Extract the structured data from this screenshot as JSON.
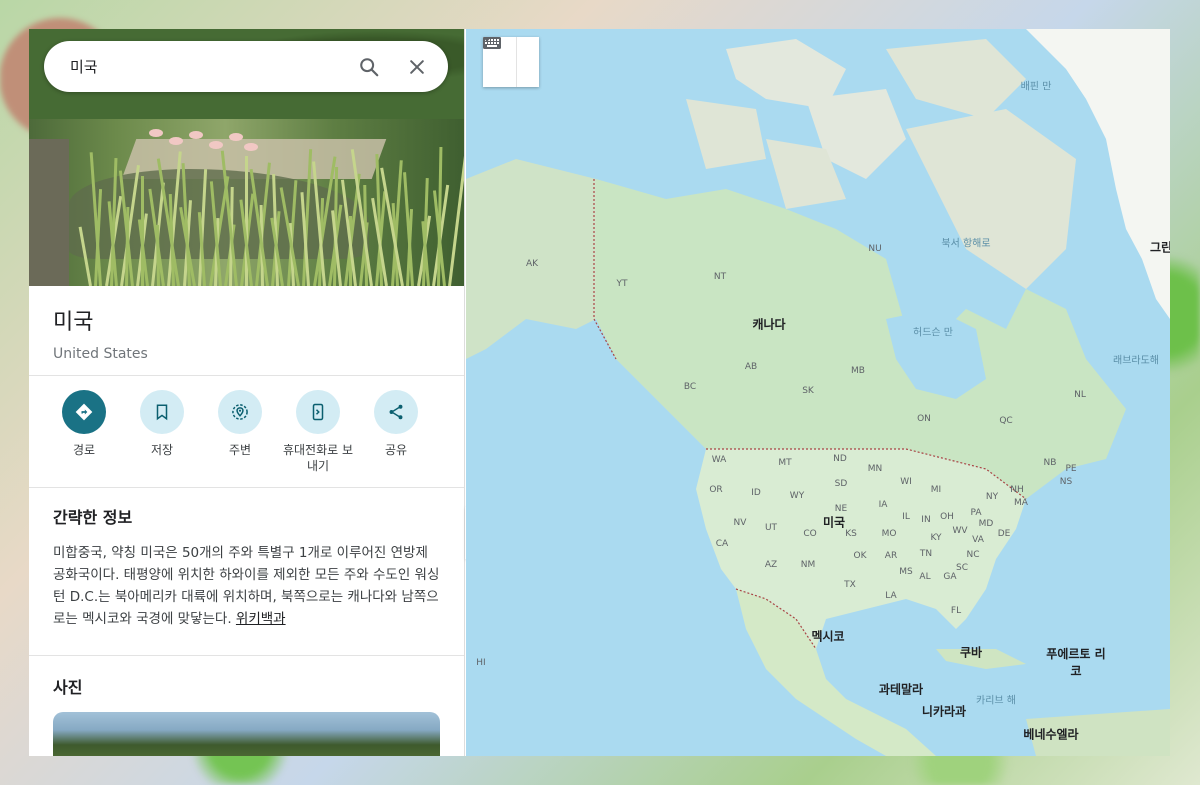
{
  "search": {
    "query": "미국"
  },
  "place": {
    "title": "미국",
    "subtitle": "United States"
  },
  "actions": [
    {
      "id": "directions",
      "label": "경로",
      "icon": "directions-icon"
    },
    {
      "id": "save",
      "label": "저장",
      "icon": "bookmark-icon"
    },
    {
      "id": "nearby",
      "label": "주변",
      "icon": "nearby-icon"
    },
    {
      "id": "send-to-phone",
      "label": "휴대전화로 보내기",
      "icon": "send-to-phone-icon"
    },
    {
      "id": "share",
      "label": "공유",
      "icon": "share-icon"
    }
  ],
  "info": {
    "title": "간략한 정보",
    "body": "미합중국, 약칭 미국은 50개의 주와 특별구 1개로 이루어진 연방제 공화국이다. 태평양에 위치한 하와이를 제외한 모든 주와 수도인 워싱턴 D.C.는 북아메리카 대륙에 위치하며, 북쪽으로는 캐나다와 남쪽으로는 멕시코와 국경에 맞닿는다.",
    "link": "위키백과"
  },
  "photos": {
    "title": "사진"
  },
  "map": {
    "countries": [
      {
        "name": "canada",
        "text": "캐나다"
      },
      {
        "name": "usa",
        "text": "미국"
      },
      {
        "name": "mexico",
        "text": "멕시코"
      },
      {
        "name": "cuba",
        "text": "쿠바"
      },
      {
        "name": "puerto-rico",
        "text": "푸에르토 리코"
      },
      {
        "name": "guatemala",
        "text": "과테말라"
      },
      {
        "name": "nicaragua",
        "text": "니카라과"
      },
      {
        "name": "venezuela",
        "text": "베네수엘라"
      },
      {
        "name": "greenland",
        "text": "그린"
      }
    ],
    "waters": [
      {
        "name": "baffin-bay",
        "text": "배핀 만"
      },
      {
        "name": "northwest-passage",
        "text": "북서 항해로"
      },
      {
        "name": "hudson-bay",
        "text": "허드슨 만"
      },
      {
        "name": "labrador-sea",
        "text": "래브라도해"
      },
      {
        "name": "caribbean-sea",
        "text": "카리브 해"
      }
    ],
    "regions": [
      "AK",
      "YT",
      "NT",
      "NU",
      "BC",
      "AB",
      "SK",
      "MB",
      "ON",
      "QC",
      "NL",
      "NB",
      "PE",
      "NS",
      "WA",
      "MT",
      "ND",
      "MN",
      "OR",
      "ID",
      "WY",
      "SD",
      "WI",
      "MI",
      "NY",
      "NH",
      "MA",
      "NE",
      "IA",
      "IL",
      "IN",
      "OH",
      "PA",
      "NV",
      "UT",
      "CO",
      "KS",
      "MO",
      "KY",
      "WV",
      "MD",
      "DE",
      "CA",
      "AZ",
      "NM",
      "OK",
      "AR",
      "TN",
      "VA",
      "NC",
      "MS",
      "AL",
      "GA",
      "SC",
      "TX",
      "LA",
      "FL",
      "HI"
    ]
  }
}
